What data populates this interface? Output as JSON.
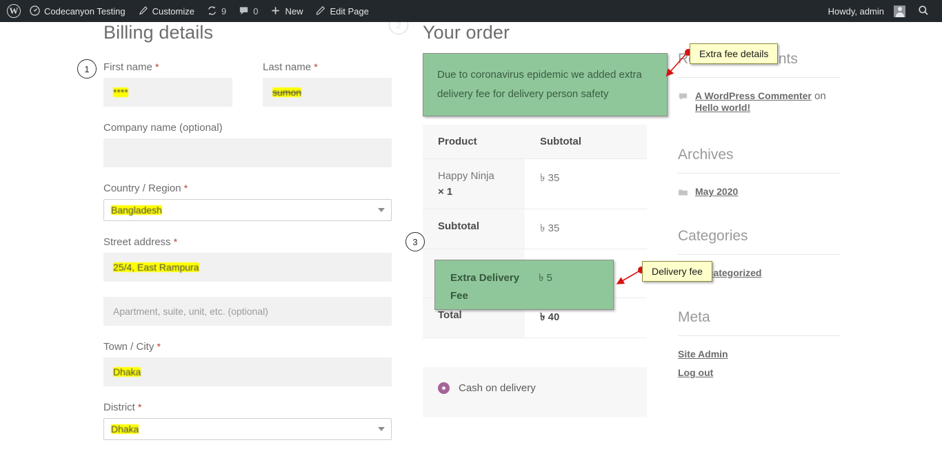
{
  "adminbar": {
    "logo_icon": "wordpress-logo-icon",
    "site_icon": "dashboard-icon",
    "site_name": "Codecanyon Testing",
    "customize_icon": "brush-icon",
    "customize_label": "Customize",
    "updates_icon": "updates-icon",
    "updates_count": "9",
    "comments_icon": "comment-bubble-icon",
    "comments_count": "0",
    "new_icon": "plus-icon",
    "new_label": "New",
    "edit_icon": "pencil-icon",
    "edit_label": "Edit Page",
    "howdy": "Howdy, admin",
    "avatar_icon": "user-avatar-icon",
    "search_icon": "search-icon"
  },
  "billing": {
    "title": "Billing details",
    "required_mark": "*",
    "fields": {
      "first_name": {
        "label": "First name",
        "value": "****",
        "required": true
      },
      "last_name": {
        "label": "Last name",
        "value": "sumon",
        "required": true
      },
      "company": {
        "label": "Company name (optional)",
        "value": "",
        "required": false
      },
      "country": {
        "label": "Country / Region",
        "value": "Bangladesh",
        "required": true
      },
      "street": {
        "label": "Street address",
        "value": "25/4, East Rampura",
        "required": true
      },
      "apartment": {
        "label": "",
        "placeholder": "Apartment, suite, unit, etc. (optional)",
        "value": "",
        "required": false
      },
      "city": {
        "label": "Town / City",
        "value": "Dhaka",
        "required": true
      },
      "district": {
        "label": "District",
        "value": "Dhaka",
        "required": true
      }
    }
  },
  "order": {
    "title": "Your order",
    "notice": "Due to coronavirus epidemic we added extra delivery fee for delivery person safety",
    "headers": {
      "product": "Product",
      "subtotal": "Subtotal"
    },
    "items": [
      {
        "name": "Happy Ninja",
        "qty": "× 1",
        "price": "৳ 35"
      }
    ],
    "rows": [
      {
        "label": "Subtotal",
        "value": "৳ 35"
      },
      {
        "label": "Extra Delivery Fee",
        "value": "৳ 5"
      },
      {
        "label": "Total",
        "value": "৳ 40"
      }
    ],
    "fee_row": {
      "label": "Extra Delivery Fee",
      "value": "৳ 5"
    },
    "payment": {
      "selected": "cash-on-delivery",
      "radio_icon": "radio-selected-icon",
      "label": "Cash on delivery"
    }
  },
  "sidebar": {
    "widgets": [
      {
        "title": "Recent Comments",
        "items": [
          {
            "icon": "comment-icon",
            "author": "A WordPress Commenter",
            "connector": " on ",
            "post": "Hello world!"
          }
        ]
      },
      {
        "title": "Archives",
        "items": [
          {
            "icon": "folder-icon",
            "label": "May 2020"
          }
        ]
      },
      {
        "title": "Categories",
        "items": [
          {
            "icon": "folder-icon",
            "label": "Uncategorized"
          }
        ]
      },
      {
        "title": "Meta",
        "items": [
          {
            "label": "Site Admin"
          },
          {
            "label": "Log out"
          }
        ]
      }
    ]
  },
  "annotations": {
    "badges": [
      {
        "number": "1"
      },
      {
        "number": "2"
      },
      {
        "number": "3"
      }
    ],
    "callouts": [
      {
        "text": "Extra fee details"
      },
      {
        "text": "Delivery fee"
      }
    ],
    "arrow_color": "#d71313",
    "highlight_color": "#8fc79a",
    "callout_bg": "#ffffcc"
  }
}
